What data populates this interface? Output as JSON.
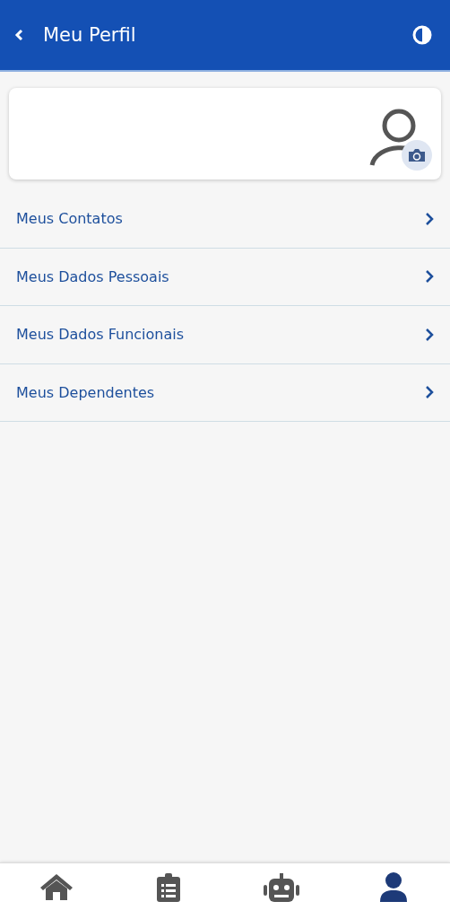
{
  "header": {
    "title": "Meu Perfil"
  },
  "menu": [
    {
      "label": "Meus Contatos"
    },
    {
      "label": "Meus Dados Pessoais"
    },
    {
      "label": "Meus Dados Funcionais"
    },
    {
      "label": "Meus Dependentes"
    }
  ],
  "tabs": [
    {
      "kind": "home",
      "selected": false
    },
    {
      "kind": "clipboard",
      "selected": false
    },
    {
      "kind": "robot",
      "selected": false
    },
    {
      "kind": "user",
      "selected": true
    }
  ]
}
